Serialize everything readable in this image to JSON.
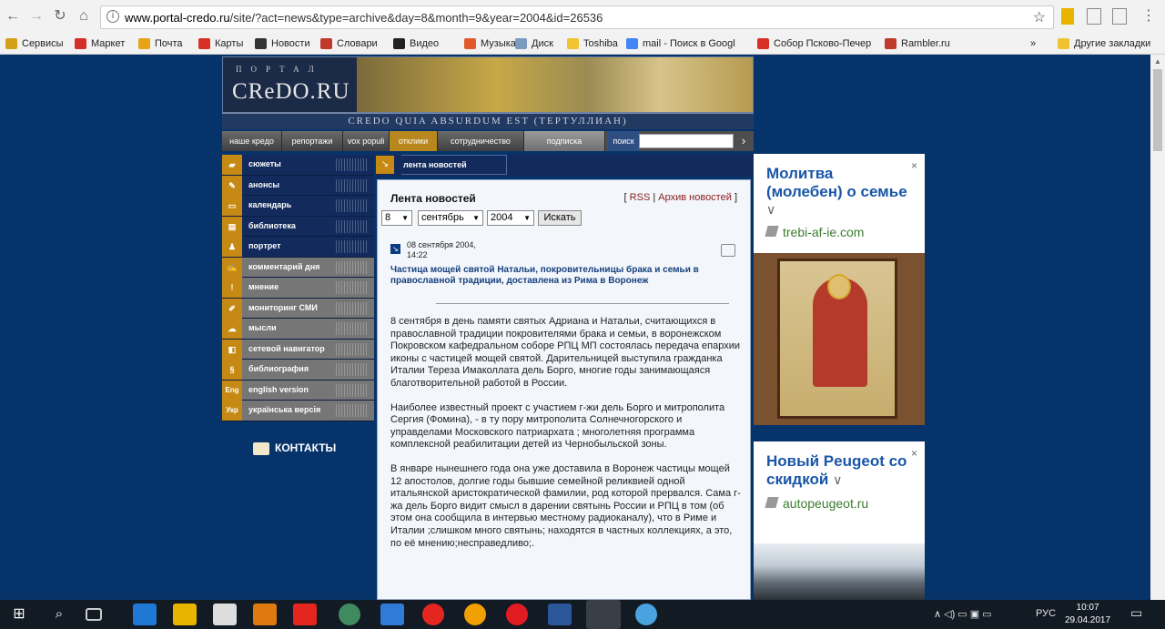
{
  "browser": {
    "url_prefix": "www.portal-credo.ru",
    "url_path": "/site/?act=news&type=archive&day=8&month=9&year=2004&id=26536",
    "bookmarks": [
      "Сервисы",
      "Маркет",
      "Почта",
      "Карты",
      "Новости",
      "Словари",
      "Видео",
      "Музыка",
      "Диск",
      "Toshiba",
      "mail - Поиск в Googl",
      "Собор Псково-Печер",
      "Rambler.ru",
      "»",
      "Другие закладки"
    ],
    "bookmark_colors": [
      "#d4a017",
      "#d4302a",
      "#e8a317",
      "#d93025",
      "#333333",
      "#c0392b",
      "#222222",
      "#e05a2b",
      "#7a9bbf",
      "#f1c232",
      "#4285f4",
      "#d93025",
      "#c0392b",
      "#ffffff",
      "#f1c232"
    ]
  },
  "site": {
    "logo_small": "ПОРТАЛ",
    "logo": "CReDO.RU",
    "tagline": "CREDO QUIA ABSURDUM EST (ТЕРТУЛЛИАН)",
    "topnav": [
      "наше кредо",
      "репортажи",
      "vox populi",
      "отклики читателей",
      "сотрудничество",
      "подписка"
    ],
    "search_label": "поиск",
    "search_arrow": "›",
    "leftmenu": [
      {
        "label": "сюжеты",
        "icon": "▰"
      },
      {
        "label": "анонсы",
        "icon": "✎"
      },
      {
        "label": "календарь",
        "icon": "▭"
      },
      {
        "label": "библиотека",
        "icon": "▤"
      },
      {
        "label": "портрет",
        "icon": "♟"
      },
      {
        "label": "комментарий дня",
        "icon": "✍"
      },
      {
        "label": "мнение",
        "icon": "!"
      },
      {
        "label": "мониторинг СМИ",
        "icon": "✐"
      },
      {
        "label": "мысли",
        "icon": "☁"
      },
      {
        "label": "сетевой навигатор",
        "icon": "◧"
      },
      {
        "label": "библиография",
        "icon": "§"
      },
      {
        "label": "english version",
        "icon": "Eng"
      },
      {
        "label": "українська версія",
        "icon": "Укр"
      }
    ],
    "contacts": "КОНТАКТЫ",
    "crumb": "лента новостей",
    "crumb_icon": "↘"
  },
  "content": {
    "title": "Лента новостей",
    "rss": "RSS",
    "archive": "Архив новостей",
    "bracket_open": "[",
    "bracket_close": "]",
    "sep": "|",
    "day": "8",
    "month": "сентябрь",
    "year": "2004",
    "search_button": "Искать",
    "date": "08 сентября 2004,",
    "time": "14:22",
    "headline": "Частица мощей святой Натальи, покровительницы брака и семьи в православной традиции, доставлена из Рима в Воронеж",
    "paragraphs": [
      "8 сентября в день памяти святых Адриана и Натальи, считающихся в православной традиции покровителями брака и семьи, в воронежском Покровском кафедральном соборе РПЦ МП состоялась передача епархии иконы с частицей мощей святой. Дарительницей выступила гражданка Италии Тереза Имаколлата дель Борго, многие годы занимающаяся благотворительной работой в России.",
      "Наиболее известный проект с участием г-жи дель Борго и митрополита Сергия (Фомина), - в ту пору митрополита Солнечногорского и управделами Московского патриархата ; многолетняя программа комплексной реабилитации детей из Чернобыльской зоны.",
      "В январе нынешнего года она уже доставила в Воронеж частицы мощей 12 апостолов, долгие годы бывшие семейной реликвией одной итальянской аристократической фамилии, род которой прервался. Сама г-жа дель Борго видит смысл в дарении святынь России и РПЦ в том (об этом она сообщила в интервью местному радиоканалу), что в Риме и Италии ;слишком много святынь; находятся в частных коллекциях, а это, по её мнению;несправедливо;."
    ]
  },
  "ads": [
    {
      "title": "Молитва (молебен) о семье",
      "chevron": "∨",
      "domain": "trebi-af-ie.com",
      "close": "×"
    },
    {
      "title": "Новый Peugeot со скидкой",
      "chevron": "∨",
      "domain": "autopeugeot.ru",
      "close": "×"
    }
  ],
  "taskbar": {
    "lang": "РУС",
    "time": "10:07",
    "date": "29.04.2017"
  }
}
